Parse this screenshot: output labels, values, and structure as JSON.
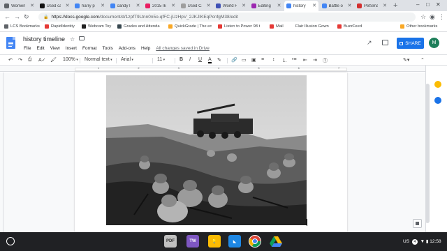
{
  "tabs": [
    {
      "title": "Women's",
      "color": "#5f6368"
    },
    {
      "title": "Used ca",
      "color": "#111111"
    },
    {
      "title": "harry p",
      "color": "#4285f4"
    },
    {
      "title": "candy l",
      "color": "#4285f4"
    },
    {
      "title": "2015 Ik",
      "color": "#e91e63"
    },
    {
      "title": "Used Ca",
      "color": "#9e9e9e"
    },
    {
      "title": "World H",
      "color": "#3f51b5"
    },
    {
      "title": "Editing",
      "color": "#9c27b0"
    },
    {
      "title": "history",
      "color": "#4285f4"
    },
    {
      "title": "Battle o",
      "color": "#4285f4"
    },
    {
      "title": "PetSma",
      "color": "#d32f2f"
    }
  ],
  "omnibox": {
    "host": "https://docs.google.com",
    "path": "/document/d/1zpfT9Ltnn0n5o-qfFC-jUzHpV_2JKJIKEqPcnfgM38/edit"
  },
  "bookmarks": [
    {
      "label": "LCS Bookmarks",
      "color": "#5f6368"
    },
    {
      "label": "RapidIdentity",
      "color": "#e53935"
    },
    {
      "label": "Webcam Toy",
      "color": "#212121"
    },
    {
      "label": "Grades and Attenda",
      "color": "#37474f"
    },
    {
      "label": "QuickGrade | The ec",
      "color": "#f9a825"
    },
    {
      "label": "Listen to Power 98 t",
      "color": "#e53935"
    },
    {
      "label": "Mail",
      "color": "#e53935"
    },
    {
      "label": "Flair Illusion Gown",
      "color": "#fff"
    },
    {
      "label": "BuzzFeed",
      "color": "#e53935"
    },
    {
      "label": "Other bookmarks",
      "color": "#f9a825"
    }
  ],
  "doc": {
    "title": "history timeline",
    "menu": [
      "File",
      "Edit",
      "View",
      "Insert",
      "Format",
      "Tools",
      "Add-ons",
      "Help"
    ],
    "saved_status": "All changes saved in Drive",
    "share_label": "SHARE",
    "avatar_letter": "M"
  },
  "toolbar": {
    "zoom": "100%",
    "style": "Normal text",
    "font": "Arial",
    "size": "11",
    "bold": "B",
    "italic": "I",
    "underline": "U",
    "text_color": "A"
  },
  "ruler": {
    "numbers": "1 2 3 4 5 6 7"
  },
  "status": {
    "locale": "US",
    "notifications": "4",
    "time": "12:58"
  },
  "colors": {
    "accent": "#1a73e8",
    "shelf": "#202124"
  }
}
